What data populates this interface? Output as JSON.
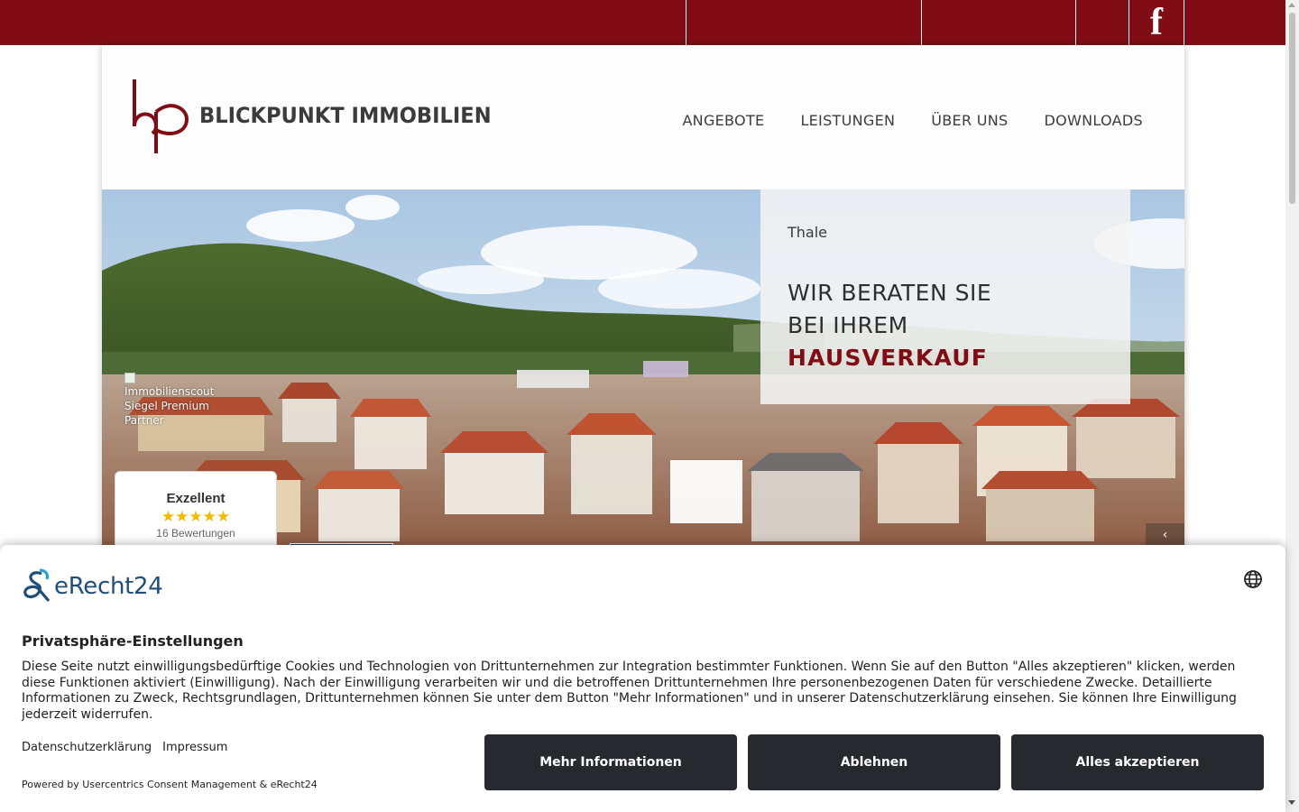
{
  "brand": {
    "name": "BLICKPUNKT IMMOBILIEN",
    "color": "#800d15"
  },
  "topbar": {
    "facebook_icon": "facebook-icon",
    "facebook_glyph": "f"
  },
  "nav": {
    "items": [
      "ANGEBOTE",
      "LEISTUNGEN",
      "ÜBER UNS",
      "DOWNLOADS"
    ]
  },
  "hero": {
    "location": "Thale",
    "line1": "WIR BERATEN SIE",
    "line2": "BEI IHREM",
    "highlight": "HAUSVERKAUF",
    "broken_image_alt": "Immobilienscout Siegel Premium Partner",
    "slider_arrow": "‹"
  },
  "rating": {
    "title": "Exzellent",
    "stars": "★★★★★",
    "count": "16 Bewertungen",
    "star_color": "#f5b800"
  },
  "cookie": {
    "logo_text": "eRecht24",
    "title": "Privatsphäre-Einstellungen",
    "text": "Diese Seite nutzt einwilligungsbedürftige Cookies und Technologien von Drittunternehmen zur Integration bestimmter Funktionen. Wenn Sie auf den Button \"Alles akzeptieren\" klicken, werden diese Funktionen aktiviert (Einwilligung). Nach der Einwilligung verarbeiten wir und die betroffenen Drittunternehmen Ihre personenbezogenen Daten für verschiedene Zwecke. Detaillierte Informationen zu Zweck, Rechtsgrundlagen, Drittunternehmen können Sie unter dem Button \"Mehr Informationen\" und in unserer Datenschutzerklärung einsehen. Sie können Ihre Einwilligung jederzeit widerrufen.",
    "link_privacy": "Datenschutzerklärung",
    "link_imprint": "Impressum",
    "powered": "Powered by Usercentrics Consent Management & eRecht24",
    "btn_more": "Mehr Informationen",
    "btn_decline": "Ablehnen",
    "btn_accept": "Alles akzeptieren",
    "button_color": "#26292e",
    "language_icon": "globe-icon"
  }
}
